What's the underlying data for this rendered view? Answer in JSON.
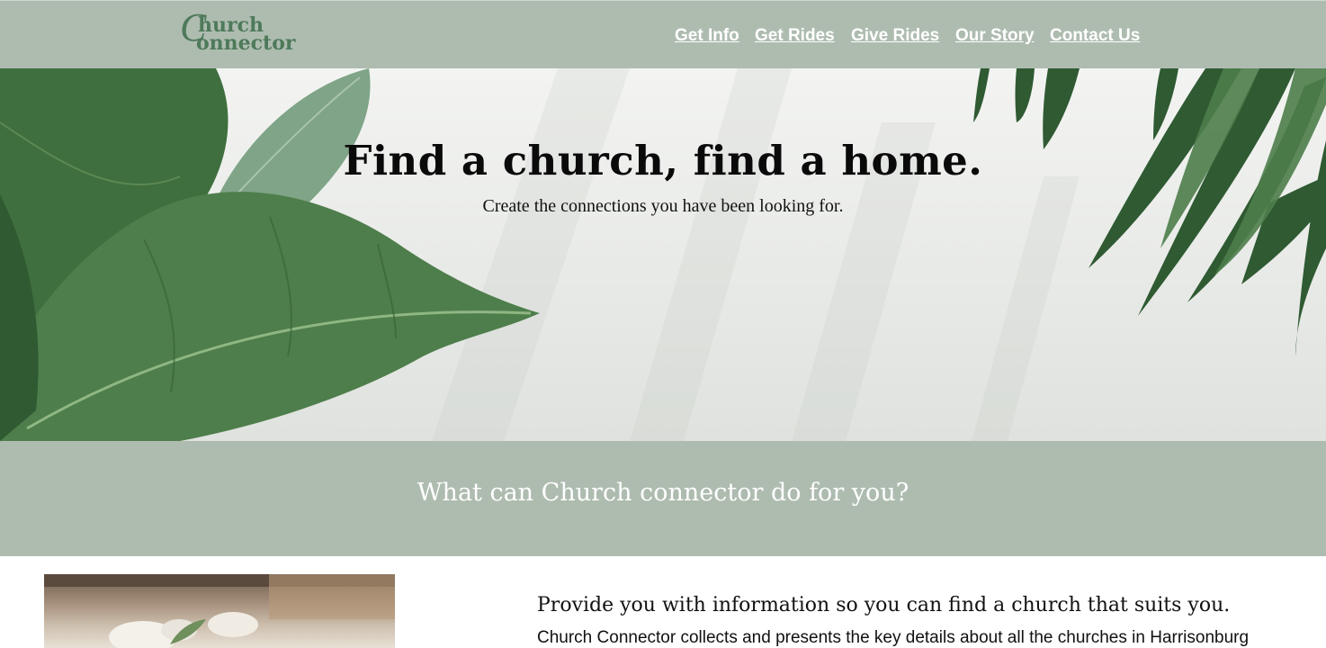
{
  "header": {
    "logo": {
      "letter": "C",
      "line1": "hurch",
      "line2": "onnector"
    },
    "nav": [
      {
        "label": "Get Info"
      },
      {
        "label": "Get Rides"
      },
      {
        "label": "Give Rides"
      },
      {
        "label": "Our Story"
      },
      {
        "label": "Contact Us"
      }
    ]
  },
  "hero": {
    "title": "Find a church, find a home.",
    "subtitle": "Create the connections you have been looking for."
  },
  "band": {
    "title": "What can Church connector do for you?"
  },
  "feature": {
    "heading": "Provide you with information so you can find a church that suits you.",
    "text": "Church Connector collects and presents the key details about all the churches in Harrisonburg"
  },
  "colors": {
    "header_bg": "#aebcb0",
    "logo": "#4e7a5a",
    "leaf_dark": "#2f5a32",
    "leaf_mid": "#4e7e4b"
  }
}
